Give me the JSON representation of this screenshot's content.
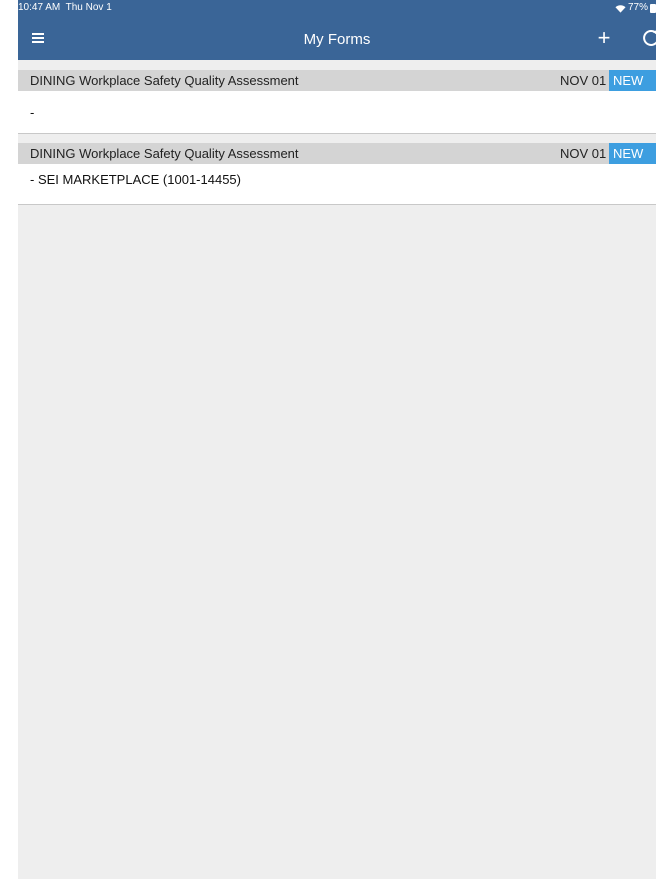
{
  "status_bar": {
    "time": "10:47 AM  Thu Nov 1",
    "battery": "77%",
    "icons": [
      "wifi-icon",
      "battery-icon"
    ]
  },
  "nav_bar": {
    "title": "My Forms",
    "icons": [
      "menu-icon",
      "add-icon",
      "refresh-icon"
    ],
    "color": "#3a6597"
  },
  "forms": [
    {
      "title": "DINING Workplace Safety Quality Assessment",
      "date": "NOV 01",
      "badge": "NEW",
      "subtitle": "-"
    },
    {
      "title": "DINING Workplace Safety Quality Assessment",
      "date": "NOV 01",
      "badge": "NEW",
      "subtitle": "- SEI MARKETPLACE (1001-14455)"
    }
  ],
  "colors": {
    "header_bg": "#3a6597",
    "badge_bg": "#3d9ee0",
    "list_bg": "#eeeeee",
    "row_header_bg": "#d4d4d4"
  }
}
